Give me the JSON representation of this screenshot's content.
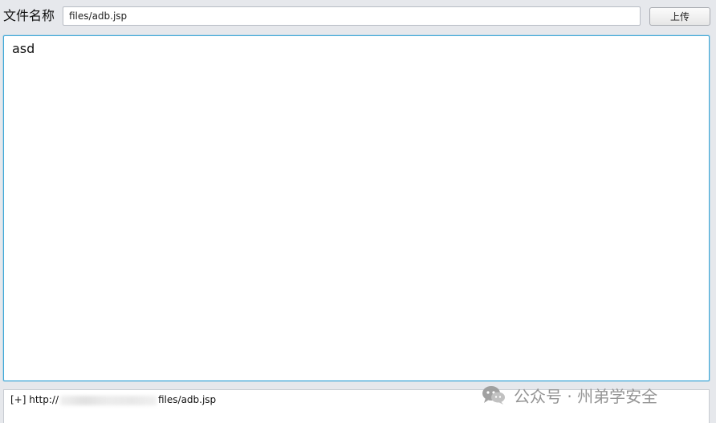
{
  "toolbar": {
    "filename_label": "文件名称",
    "filename_value": "files/adb.jsp",
    "upload_label": "上传"
  },
  "editor": {
    "content": "asd"
  },
  "log": {
    "prefix": "[+] http://",
    "suffix": "files/adb.jsp"
  },
  "watermark": {
    "text": "公众号 · 州弟学安全",
    "icon": "wechat-icon"
  }
}
